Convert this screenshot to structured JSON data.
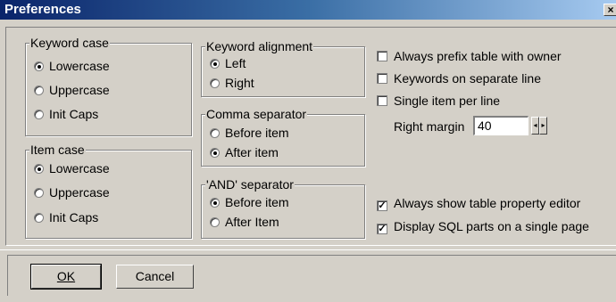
{
  "window": {
    "title": "Preferences",
    "close_glyph": "×"
  },
  "keyword_case": {
    "legend": "Keyword case",
    "options": [
      {
        "label": "Lowercase",
        "selected": true
      },
      {
        "label": "Uppercase",
        "selected": false
      },
      {
        "label": "Init Caps",
        "selected": false
      }
    ]
  },
  "item_case": {
    "legend": "Item case",
    "options": [
      {
        "label": "Lowercase",
        "selected": true
      },
      {
        "label": "Uppercase",
        "selected": false
      },
      {
        "label": "Init Caps",
        "selected": false
      }
    ]
  },
  "keyword_alignment": {
    "legend": "Keyword alignment",
    "options": [
      {
        "label": "Left",
        "selected": true
      },
      {
        "label": "Right",
        "selected": false
      }
    ]
  },
  "comma_separator": {
    "legend": "Comma separator",
    "options": [
      {
        "label": "Before item",
        "selected": false
      },
      {
        "label": "After item",
        "selected": true
      }
    ]
  },
  "and_separator": {
    "legend": "'AND' separator",
    "options": [
      {
        "label": "Before item",
        "selected": true
      },
      {
        "label": "After Item",
        "selected": false
      }
    ]
  },
  "checkboxes": [
    {
      "label": "Always prefix table with owner",
      "checked": false
    },
    {
      "label": "Keywords on separate line",
      "checked": false
    },
    {
      "label": "Single item per line",
      "checked": false
    },
    {
      "label": "Always show table property editor",
      "checked": true
    },
    {
      "label": "Display SQL parts on a single page",
      "checked": true
    }
  ],
  "right_margin": {
    "label": "Right margin",
    "value": "40"
  },
  "buttons": {
    "ok": "OK",
    "cancel": "Cancel"
  }
}
